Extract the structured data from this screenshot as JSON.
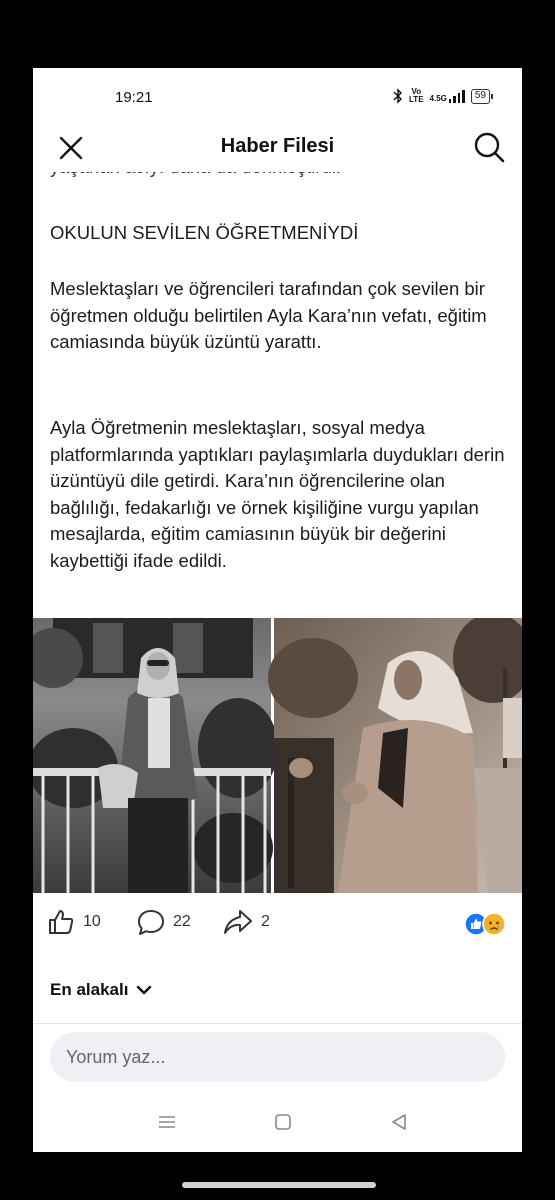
{
  "status": {
    "time": "19:21",
    "volte_top": "Vo",
    "volte_bottom": "LTE",
    "network": "4.5G",
    "battery": "59"
  },
  "header": {
    "title": "Haber Filesi"
  },
  "article": {
    "clipped_line": "yaşanan acıyı daha da derinleştirdi.",
    "heading": "OKULUN SEVİLEN ÖĞRETMENİYDİ",
    "paragraph1": "Meslektaşları ve öğrencileri tarafından çok sevilen bir öğretmen olduğu belirtilen Ayla Kara’nın vefatı, eğitim camiasında büyük üzüntü yarattı.",
    "paragraph2": "Ayla Öğretmenin meslektaşları, sosyal medya platformlarında yaptıkları paylaşımlarla duydukları derin üzüntüyü dile getirdi. Kara’nın öğrencilerine olan bağlılığı, fedakarlığı ve örnek kişiliğine vurgu yapılan mesajlarda, eğitim camiasının büyük bir değerini kaybettiği ifade edildi."
  },
  "reactions": {
    "likes": "10",
    "comments": "22",
    "shares": "2"
  },
  "sort": {
    "label": "En alakalı"
  },
  "comment": {
    "placeholder": "Yorum yaz..."
  },
  "icons": {
    "close": "close-icon",
    "search": "search-icon",
    "like": "thumbs-up-icon",
    "comment": "comment-icon",
    "share": "share-icon",
    "menu": "menu-icon",
    "home": "home-icon",
    "back": "back-icon"
  },
  "colors": {
    "like_badge": "#1877f2",
    "sad_badge": "#f7b125"
  }
}
